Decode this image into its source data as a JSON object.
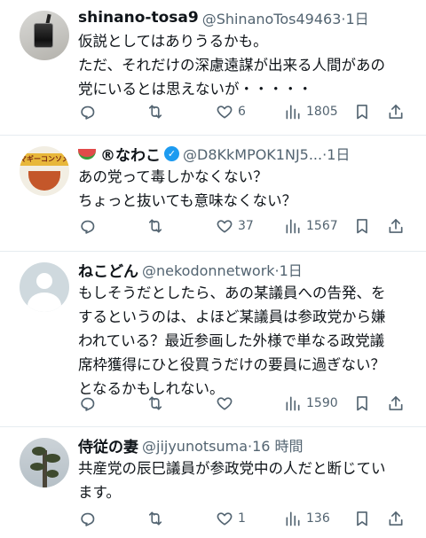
{
  "tweets": [
    {
      "name": "shinano-tosa9",
      "handle": "@ShinanoTos49463",
      "time": "1日",
      "lines": [
        "仮説としてはありうるかも。",
        "ただ、それだけの深慮遠謀が出来る人間があの",
        "党にいるとは思えないが・・・・・"
      ],
      "replies": "",
      "retweets": "",
      "likes": "6",
      "views": "1805",
      "avatar": "drink-glass-photo"
    },
    {
      "name": "®なわこ",
      "handle": "@D8KkMPOK1NJ5...",
      "time": "1日",
      "verified": true,
      "lines": [
        "あの党って毒しかなくない？",
        "ちょっと抜いても意味なくない？"
      ],
      "replies": "",
      "retweets": "",
      "likes": "37",
      "views": "1567",
      "avatar": "soup-package-photo",
      "avatar_label": "マギーコンソメ"
    },
    {
      "name": "ねこどん",
      "handle": "@nekodonnetwork",
      "time": "1日",
      "lines": [
        "もしそうだとしたら、あの某議員への告発、を",
        "するというのは、よほど某議員は参政党から嫌",
        "われている？最近参画した外様で単なる政党議",
        "席枠獲得にひと役買うだけの要員に過ぎない？",
        "となるかもしれない。"
      ],
      "replies": "",
      "retweets": "",
      "likes": "",
      "views": "1590",
      "avatar": "default-avatar"
    },
    {
      "name": "侍従の妻",
      "handle": "@jijyunotsuma",
      "time": "16 時間",
      "lines": [
        "共産党の辰巳議員が参政党中の人だと断じてい",
        "ます。"
      ],
      "replies": "",
      "retweets": "",
      "likes": "1",
      "views": "136",
      "avatar": "tree-photo"
    }
  ],
  "icons": [
    "reply-icon",
    "retweet-icon",
    "like-icon",
    "views-icon",
    "bookmark-icon",
    "share-icon"
  ],
  "colors": {
    "text": "#0f1419",
    "secondary": "#536471",
    "verified": "#1d9bf0",
    "divider": "#e6ecf0"
  }
}
